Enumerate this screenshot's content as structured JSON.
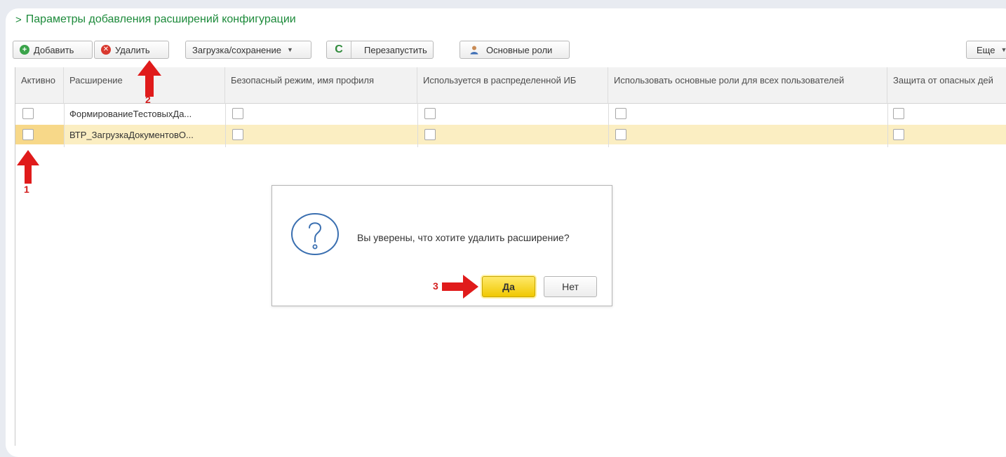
{
  "form": {
    "title": "Параметры добавления расширений конфигурации"
  },
  "toolbar": {
    "add_label": "Добавить",
    "delete_label": "Удалить",
    "load_save_label": "Загрузка/сохранение",
    "restart_label": "Перезапустить",
    "main_roles_label": "Основные роли",
    "more_label": "Еще"
  },
  "table": {
    "columns": [
      "Активно",
      "Расширение",
      "Безопасный режим, имя профиля",
      "Используется в распределенной ИБ",
      "Использовать основные роли для всех пользователей",
      "Защита от опасных дей"
    ],
    "rows": [
      {
        "active": false,
        "extension": "ФормированиеТестовыхДа...",
        "selected": false
      },
      {
        "active": false,
        "extension": "ВТР_ЗагрузкаДокументовО...",
        "selected": true
      }
    ]
  },
  "dialog": {
    "message": "Вы уверены, что хотите удалить расширение?",
    "yes_label": "Да",
    "no_label": "Нет"
  },
  "annotations": {
    "step1": "1",
    "step2": "2",
    "step3": "3"
  },
  "colors": {
    "title_green": "#1c8a3a",
    "selected_row": "#fbeec2",
    "yes_button": "#f5d000",
    "annotation_red": "#d31d1d"
  }
}
